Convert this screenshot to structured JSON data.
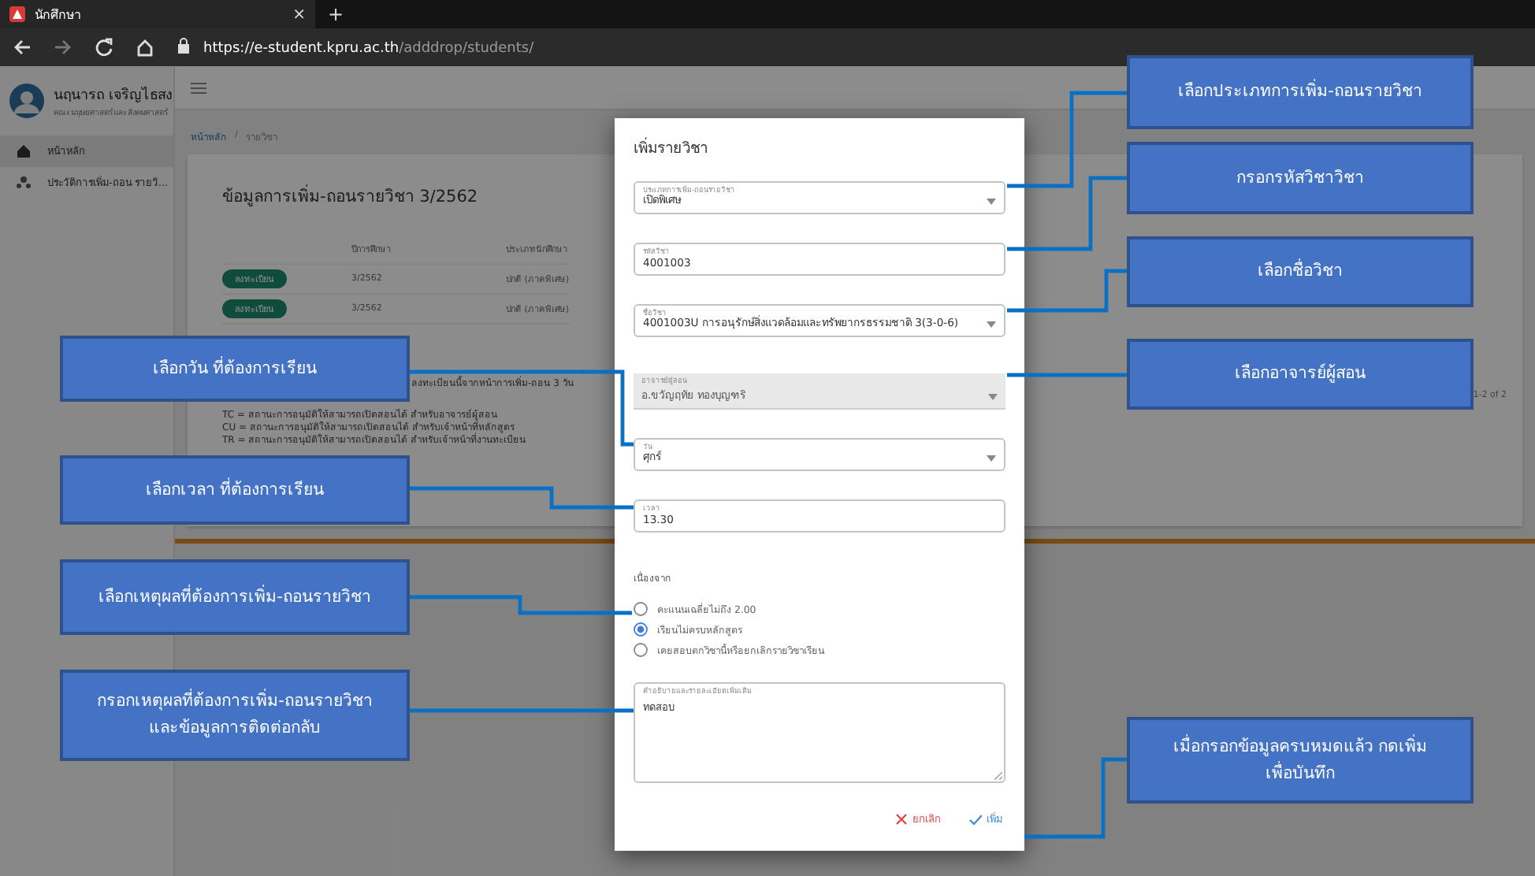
{
  "browser": {
    "tab_title": "นักศึกษา",
    "tab_close": "×",
    "new_tab": "+",
    "url_host": "https://e-student.kpru.ac.th",
    "url_path": "/adddrop/students/"
  },
  "sidebar": {
    "user_name": "นฤนารถ เจริญไธสง",
    "user_subtitle": "คณะมนุษยศาสตร์และสังคมศาสตร์",
    "items": [
      {
        "label": "หน้าหลัก",
        "selected": true
      },
      {
        "label": "ประวัติการเพิ่ม-ถอน รายวิ...",
        "selected": false
      }
    ]
  },
  "page": {
    "breadcrumb": {
      "items": [
        "หน้าหลัก",
        "รายวิชา"
      ],
      "separator": "/"
    },
    "card_title": "ข้อมูลการเพิ่ม-ถอนรายวิชา 3/2562",
    "table": {
      "columns": [
        "ปีการศึกษา",
        "ประเภทนักศึกษา"
      ],
      "rows": [
        {
          "status": "ลงทะเบียน",
          "term": "3/2562",
          "type": "ปกติ (ภาคพิเศษ)"
        },
        {
          "status": "ลงทะเบียน",
          "term": "3/2562",
          "type": "ปกติ (ภาคพิเศษ)"
        }
      ]
    },
    "notes": [
      "ลงทะเบียนนี้จากหน้าการเพิ่ม-ถอน 3 วัน",
      "TC = สถานะการอนุมัติให้สามารถเปิดสอนได้ สำหรับอาจารย์ผู้สอน",
      "CU = สถานะการอนุมัติให้สามารถเปิดสอนได้ สำหรับเจ้าหน้าที่หลักสูตร",
      "TR = สถานะการอนุมัติให้สามารถเปิดสอนได้ สำหรับเจ้าหน้าที่งานทะเบียน"
    ],
    "pagination": "1-2 of 2"
  },
  "dialog": {
    "title": "เพิ่มรายวิชา",
    "fields": [
      {
        "kind": "select",
        "label": "ประเภทการเพิ่ม-ถอนรายวิชา",
        "value": "เปิดพิเศษ",
        "disabled": false
      },
      {
        "kind": "text",
        "label": "รหัสวิชา",
        "value": "4001003",
        "disabled": false
      },
      {
        "kind": "select",
        "label": "ชื่อวิชา",
        "value": "4001003U การอนุรักษ์สิ่งแวดล้อมและทรัพยากรธรรมชาติ 3(3-0-6)",
        "disabled": false
      },
      {
        "kind": "select",
        "label": "อาจารย์ผู้สอน",
        "value": "อ.ขวัญฤทัย ทองบุญฑริ",
        "disabled": true
      },
      {
        "kind": "select",
        "label": "วัน",
        "value": "ศุกร์",
        "disabled": false
      },
      {
        "kind": "text",
        "label": "เวลา",
        "value": "13.30",
        "disabled": false
      }
    ],
    "reason_label": "เนื่องจาก",
    "reasons": [
      {
        "label": "คะแนนเฉลี่ยไม่ถึง 2.00",
        "selected": false
      },
      {
        "label": "เรียนไม่ครบหลักสูตร",
        "selected": true
      },
      {
        "label": "เคยสอบตกวิชานี้หรือยกเลิกรายวิชาเรียน",
        "selected": false
      }
    ],
    "textarea": {
      "label": "คำอธิบายและรายละเอียดเพิ่มเติม",
      "value": "ทดสอบ"
    },
    "buttons": [
      {
        "kind": "cancel",
        "label": "ยกเลิก"
      },
      {
        "kind": "confirm",
        "label": "เพิ่ม"
      }
    ]
  },
  "callouts": [
    {
      "lines": [
        "เลือกประเภทการเพิ่ม-ถอนรายวิชา"
      ]
    },
    {
      "lines": [
        "กรอกรหัสวิชาวิชา"
      ]
    },
    {
      "lines": [
        "เลือกชื่อวิชา"
      ]
    },
    {
      "lines": [
        "เลือกวัน ที่ต้องการเรียน"
      ]
    },
    {
      "lines": [
        "เลือกอาจารย์ผู้สอน"
      ]
    },
    {
      "lines": [
        "เลือกเวลา ที่ต้องการเรียน"
      ]
    },
    {
      "lines": [
        "เลือกเหตุผลที่ต้องการเพิ่ม-ถอนรายวิชา"
      ]
    },
    {
      "lines": [
        "กรอกเหตุผลที่ต้องการเพิ่ม-ถอนรายวิชา",
        "และข้อมูลการติดต่อกลับ"
      ]
    },
    {
      "lines": [
        "เมื่อกรอกข้อมูลครบหมดแล้ว กดเพิ่ม",
        "เพื่อบันทึก"
      ]
    }
  ]
}
